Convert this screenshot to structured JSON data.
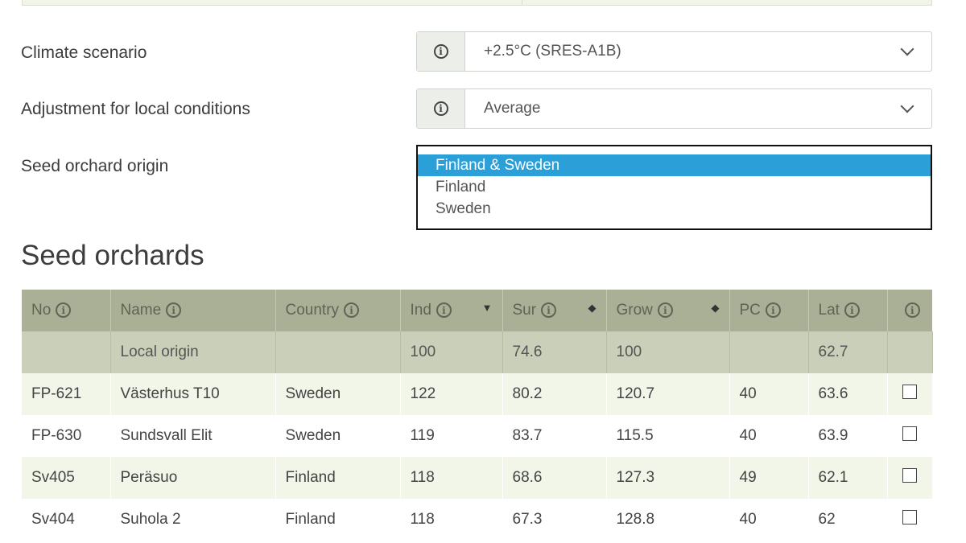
{
  "form": {
    "climate_scenario": {
      "label": "Climate scenario",
      "value": "+2.5°C (SRES-A1B)"
    },
    "local_conditions": {
      "label": "Adjustment for local conditions",
      "value": "Average"
    },
    "seed_orchard_origin": {
      "label": "Seed orchard origin",
      "options": [
        "Finland & Sweden",
        "Finland",
        "Sweden"
      ],
      "selected": "Finland & Sweden"
    }
  },
  "section_title": "Seed orchards",
  "table": {
    "columns": [
      "No",
      "Name",
      "Country",
      "Ind",
      "Sur",
      "Grow",
      "PC",
      "Lat"
    ],
    "local_origin": {
      "name": "Local origin",
      "ind": "100",
      "sur": "74.6",
      "grow": "100",
      "lat": "62.7"
    },
    "rows": [
      {
        "no": "FP-621",
        "name": "Västerhus T10",
        "country": "Sweden",
        "ind": "122",
        "sur": "80.2",
        "grow": "120.7",
        "pc": "40",
        "lat": "63.6"
      },
      {
        "no": "FP-630",
        "name": "Sundsvall Elit",
        "country": "Sweden",
        "ind": "119",
        "sur": "83.7",
        "grow": "115.5",
        "pc": "40",
        "lat": "63.9"
      },
      {
        "no": "Sv405",
        "name": "Peräsuo",
        "country": "Finland",
        "ind": "118",
        "sur": "68.6",
        "grow": "127.3",
        "pc": "49",
        "lat": "62.1"
      },
      {
        "no": "Sv404",
        "name": "Suhola 2",
        "country": "Finland",
        "ind": "118",
        "sur": "67.3",
        "grow": "128.8",
        "pc": "40",
        "lat": "62"
      }
    ]
  },
  "icons": {
    "info": "info-circle-icon",
    "chevron": "chevron-down-icon",
    "sort_desc": "sort-descending-icon",
    "sort_both": "sort-both-icon"
  },
  "colors": {
    "header_bg": "#a9b096",
    "local_row_bg": "#c9cfb8",
    "alt_row_bg": "#f1f6e9",
    "link_green": "#5f9a3a",
    "selected_option": "#2a9fd8"
  }
}
